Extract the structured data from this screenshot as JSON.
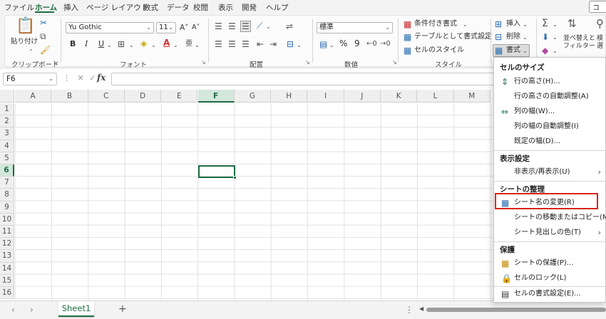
{
  "tabs": [
    "ファイル",
    "ホーム",
    "挿入",
    "ページ レイアウト",
    "数式",
    "データ",
    "校閲",
    "表示",
    "開発",
    "ヘルプ"
  ],
  "top_right_label": "コ",
  "ribbon": {
    "clipboard": {
      "paste_label": "貼り付け",
      "group_label": "クリップボード"
    },
    "font": {
      "font_name": "Yu Gothic",
      "font_size": "11",
      "grow": "A˄",
      "shrink": "A˅",
      "bold": "B",
      "italic": "I",
      "underline": "U",
      "group_label": "フォント"
    },
    "alignment": {
      "group_label": "配置"
    },
    "number": {
      "format": "標準",
      "percent": "%",
      "comma": "9",
      "group_label": "数値"
    },
    "styles": {
      "conditional": "条件付き書式",
      "table": "テーブルとして書式設定",
      "cell_styles": "セルのスタイル",
      "group_label": "スタイル"
    },
    "cells": {
      "insert": "挿入",
      "delete": "削除",
      "format": "書式"
    },
    "editing": {
      "sort_filter_1": "並べ替えと",
      "sort_filter_2": "フィルター",
      "find_1": "検",
      "find_2": "選"
    }
  },
  "formula_bar": {
    "cell_ref": "F6",
    "fx": "fx"
  },
  "grid": {
    "columns": [
      "A",
      "B",
      "C",
      "D",
      "E",
      "F",
      "G",
      "H",
      "I",
      "J",
      "K",
      "L",
      "M"
    ],
    "rows": [
      "1",
      "2",
      "3",
      "4",
      "5",
      "6",
      "7",
      "8",
      "9",
      "10",
      "11",
      "12",
      "13",
      "14",
      "15",
      "16"
    ],
    "selected_column": "F",
    "selected_row": "6"
  },
  "sheets": {
    "active": "Sheet1",
    "add": "+"
  },
  "menu": {
    "sections": [
      {
        "header": "セルのサイズ"
      },
      {
        "header": "表示設定"
      },
      {
        "header": "シートの整理"
      },
      {
        "header": "保護"
      }
    ],
    "items": {
      "row_height": "行の高さ(H)...",
      "autofit_row": "行の高さの自動調整(A)",
      "col_width": "列の幅(W)...",
      "autofit_col": "列の幅の自動調整(I)",
      "default_width": "既定の幅(D)...",
      "hide_unhide": "非表示/再表示(U)",
      "rename_sheet": "シート名の変更(R)",
      "move_copy": "シートの移動またはコピー(M)...",
      "tab_color": "シート見出しの色(T)",
      "protect_sheet": "シートの保護(P)...",
      "lock_cell": "セルのロック(L)",
      "format_cells": "セルの書式設定(E)..."
    }
  }
}
